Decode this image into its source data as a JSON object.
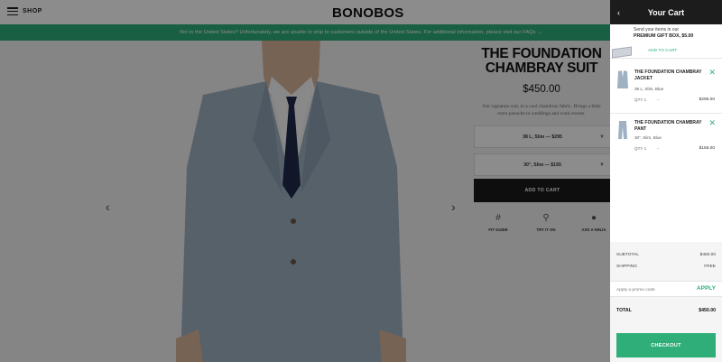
{
  "header": {
    "menu_label": "SHOP",
    "logo": "BONOBOS"
  },
  "banner": {
    "text": "Not in the United States? Unfortunately, we are unable to ship to customers outside of the United States. For additional information, please visit our FAQs →"
  },
  "product": {
    "title_line1": "THE FOUNDATION",
    "title_line2": "CHAMBRAY SUIT",
    "price": "$450.00",
    "description_line1": "Our signature suit, in a cool chambray fabric. Brings a little",
    "description_line2": "extra panache to weddings and work events.",
    "jacket_select": "38 L, Slim — $295",
    "pant_select": "30\", Slim — $155",
    "add_to_cart": "ADD TO CART",
    "tools": [
      {
        "label": "FIT GUIDE",
        "icon": "ruler-grid-icon"
      },
      {
        "label": "TRY IT ON",
        "icon": "location-pin-icon"
      },
      {
        "label": "ASK A NINJA",
        "icon": "chat-bubble-icon"
      }
    ]
  },
  "cart": {
    "title": "Your Cart",
    "gift": {
      "line1": "Send your items in our",
      "line2": "PREMIUM GIFT BOX, $5.00",
      "add": "ADD TO CART"
    },
    "items": [
      {
        "name_line1": "THE FOUNDATION CHAMBRAY",
        "name_line2": "JACKET",
        "meta": "38 L, Slim, Blue",
        "qty": "QTY 1",
        "price": "$295.00"
      },
      {
        "name_line1": "THE FOUNDATION CHAMBRAY",
        "name_line2": "PANT",
        "meta": "30\", Slim, Blue",
        "qty": "QTY 1",
        "price": "$155.00"
      }
    ],
    "summary": {
      "subtotal_label": "SUBTOTAL",
      "subtotal": "$450.00",
      "shipping_label": "SHIPPING",
      "shipping": "FREE",
      "promo_placeholder": "Apply a promo code",
      "apply": "APPLY",
      "total_label": "TOTAL",
      "total": "$450.00",
      "checkout": "CHECKOUT"
    }
  },
  "colors": {
    "accent_green": "#2fae7a",
    "dark": "#1c1c1c"
  }
}
